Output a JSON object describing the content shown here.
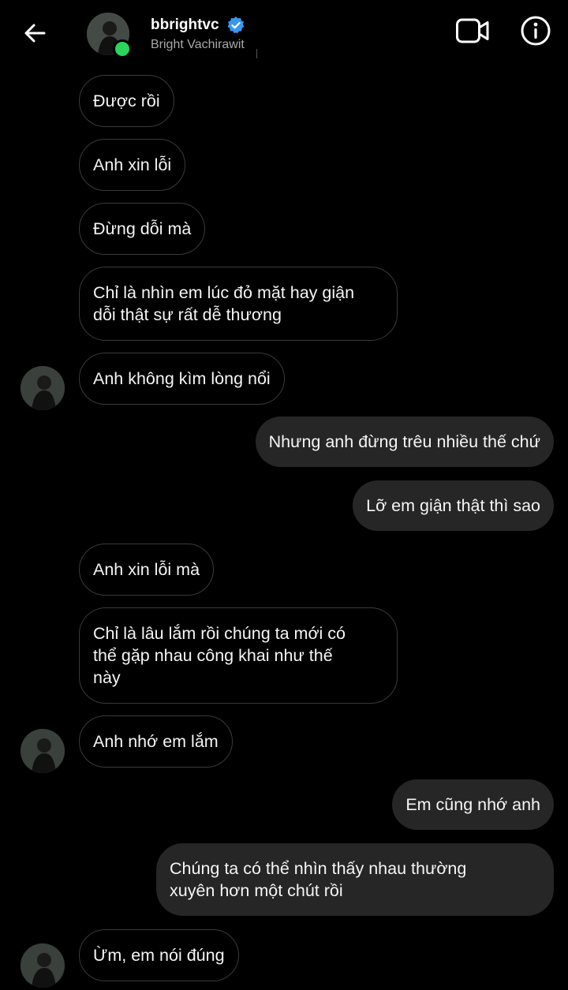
{
  "header": {
    "username": "bbrightvc",
    "full_name": "Bright Vachirawit",
    "back_icon": "arrow-left-icon",
    "video_icon": "video-camera-icon",
    "info_icon": "info-circle-icon",
    "verified_icon": "verified-badge-icon",
    "online_color": "#2bd45a",
    "verified_color": "#3897f0"
  },
  "messages": [
    {
      "from": "them",
      "text": "Được rồi"
    },
    {
      "from": "them",
      "text": "Anh xin lỗi"
    },
    {
      "from": "them",
      "text": "Đừng dỗi mà"
    },
    {
      "from": "them",
      "text": "Chỉ là nhìn em lúc đỏ mặt hay giận\ndỗi thật sự rất dễ thương"
    },
    {
      "from": "them",
      "text": "Anh không kìm lòng nổi"
    },
    {
      "from": "me",
      "text": "Nhưng anh đừng trêu nhiều thế chứ"
    },
    {
      "from": "me",
      "text": "Lỡ em giận thật thì sao"
    },
    {
      "from": "them",
      "text": "Anh xin lỗi mà"
    },
    {
      "from": "them",
      "text": "Chỉ là lâu lắm rồi chúng ta mới có\nthể gặp nhau công khai như thế\nnày"
    },
    {
      "from": "them",
      "text": "Anh nhớ em lắm"
    },
    {
      "from": "me",
      "text": "Em cũng nhớ anh"
    },
    {
      "from": "me",
      "text": "Chúng ta có thể nhìn thấy nhau thường\nxuyên hơn một chút rồi"
    },
    {
      "from": "them",
      "text": "Ừm, em nói đúng"
    }
  ],
  "colors": {
    "background": "#000000",
    "incoming_border": "#3a3a3a",
    "outgoing_bubble": "#262626",
    "text": "#f5f5f5",
    "subtext": "#a8a8a8"
  }
}
